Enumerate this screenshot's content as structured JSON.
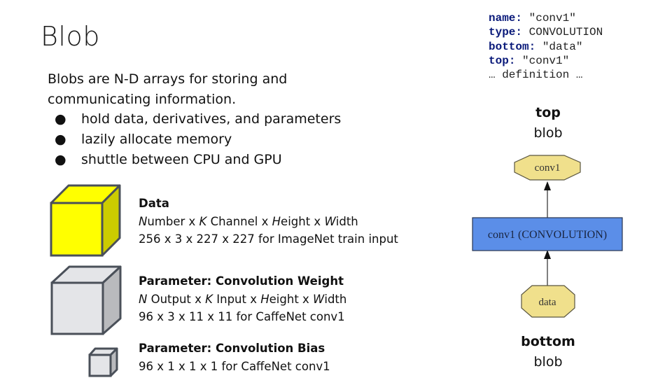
{
  "slide": {
    "title": "Blob",
    "intro_lines": [
      "Blobs are N-D arrays for storing and",
      "communicating information."
    ],
    "bullets": [
      "hold data, derivatives, and parameters",
      "lazily allocate memory",
      "shuttle between CPU and GPU"
    ],
    "bullet_glyph": "●"
  },
  "blobs": [
    {
      "heading": "Data",
      "dims_italic": [
        "N",
        "K",
        "H",
        "W"
      ],
      "dims_line": [
        "umber x ",
        " Channel x ",
        "eight x ",
        "idth"
      ],
      "example": "256 x 3 x 227 x 227 for ImageNet train input",
      "cube_color": "#ffff00",
      "cube_side_color": "#cccc00"
    },
    {
      "heading": "Parameter: Convolution Weight",
      "dims_italic": [
        "N",
        "K",
        "H",
        "W"
      ],
      "dims_line": [
        " Output x ",
        " Input x ",
        "eight x ",
        "idth"
      ],
      "example": "96 x 3 x 11 x 11 for CaffeNet conv1",
      "cube_color": "#e4e5e8",
      "cube_side_color": "#b9babd"
    },
    {
      "heading": "Parameter: Convolution Bias",
      "example": "96 x 1 x 1 x 1 for CaffeNet conv1",
      "cube_color": "#e4e5e8",
      "cube_side_color": "#b9babd"
    }
  ],
  "layer_definition": [
    {
      "key": "name",
      "value": " \"conv1\""
    },
    {
      "key": "type",
      "value": " CONVOLUTION"
    },
    {
      "key": "bottom",
      "value": " \"data\""
    },
    {
      "key": "top",
      "value": " \"conv1\""
    },
    {
      "key": "",
      "value": "… definition …"
    }
  ],
  "graph": {
    "top_label_bold": "top",
    "top_label": "blob",
    "top_blob": "conv1",
    "layer": "conv1 (CONVOLUTION)",
    "bottom_blob": "data",
    "bottom_label_bold": "bottom",
    "bottom_label": "blob",
    "blob_color": "#f0e08c",
    "layer_color": "#5b8ee8"
  }
}
